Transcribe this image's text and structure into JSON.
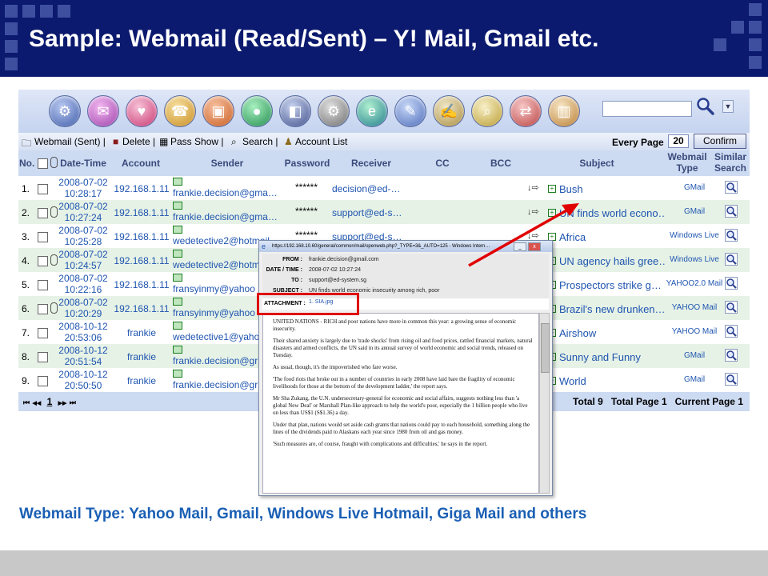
{
  "slide": {
    "title": "Sample: Webmail (Read/Sent) – Y! Mail, Gmail etc.",
    "caption": "Webmail Type: Yahoo Mail, Gmail, Windows Live Hotmail, Giga Mail and others"
  },
  "toolbar": {
    "icons": [
      "users-icon",
      "mail-icon",
      "lips-icon",
      "chat-icon",
      "package-icon",
      "globe-icon",
      "app-icon",
      "gear-icon",
      "ie-icon",
      "tools-icon",
      "notes-icon",
      "document-search-icon",
      "mail-arrows-icon",
      "bar-chart-icon"
    ],
    "search_value": ""
  },
  "menu": {
    "items": [
      "Webmail (Sent) |",
      "Delete |",
      "Pass Show |",
      "Search |",
      "Account List"
    ],
    "every_page_label": "Every Page",
    "every_page_value": "20",
    "confirm_label": "Confirm"
  },
  "table": {
    "headers": {
      "no": "No.",
      "datetime": "Date-Time",
      "account": "Account",
      "sender": "Sender",
      "password": "Password",
      "receiver": "Receiver",
      "cc": "CC",
      "bcc": "BCC",
      "subject": "Subject",
      "webmail_type": "Webmail Type",
      "similar_search": "Similar Search"
    },
    "rows": [
      {
        "no": "1.",
        "date": "2008-07-02",
        "time": "10:28:17",
        "account": "192.168.1.11",
        "sender": "frankie.decision@gma…",
        "password": "******",
        "receiver": "decision@ed-…",
        "subject": "Bush",
        "webmail": "GMail"
      },
      {
        "no": "2.",
        "date": "2008-07-02",
        "time": "10:27:24",
        "account": "192.168.1.11",
        "sender": "frankie.decision@gma…",
        "password": "******",
        "receiver": "support@ed-s…",
        "subject": "UN finds world econo…",
        "webmail": "GMail"
      },
      {
        "no": "3.",
        "date": "2008-07-02",
        "time": "10:25:28",
        "account": "192.168.1.11",
        "sender": "wedetective2@hotmail",
        "password": "******",
        "receiver": "support@ed-s…",
        "subject": "Africa",
        "webmail": "Windows Live"
      },
      {
        "no": "4.",
        "date": "2008-07-02",
        "time": "10:24:57",
        "account": "192.168.1.11",
        "sender": "wedetective2@hotmail",
        "password": "",
        "receiver": "",
        "subject": "UN agency hails gree…",
        "webmail": "Windows Live"
      },
      {
        "no": "5.",
        "date": "2008-07-02",
        "time": "10:22:16",
        "account": "192.168.1.11",
        "sender": "fransyinmy@yahoo",
        "password": "",
        "receiver": "",
        "subject": "Prospectors strike g…",
        "webmail": "YAHOO2.0 Mail"
      },
      {
        "no": "6.",
        "date": "2008-07-02",
        "time": "10:20:29",
        "account": "192.168.1.11",
        "sender": "fransyinmy@yahoo",
        "password": "",
        "receiver": "",
        "subject": "Brazil's new drunken…",
        "webmail": "YAHOO Mail"
      },
      {
        "no": "7.",
        "date": "2008-10-12",
        "time": "20:53:06",
        "account": "frankie",
        "sender": "wedetective1@yaho",
        "password": "",
        "receiver": "",
        "subject": "Airshow",
        "webmail": "YAHOO Mail"
      },
      {
        "no": "8.",
        "date": "2008-10-12",
        "time": "20:51:54",
        "account": "frankie",
        "sender": "frankie.decision@gr",
        "password": "",
        "receiver": "",
        "subject": "Sunny and Funny",
        "webmail": "GMail"
      },
      {
        "no": "9.",
        "date": "2008-10-12",
        "time": "20:50:50",
        "account": "frankie",
        "sender": "frankie.decision@gr",
        "password": "",
        "receiver": "",
        "subject": "World",
        "webmail": "GMail"
      }
    ]
  },
  "pager": {
    "nav_first": "⏮",
    "nav_prev": "◀◀",
    "current": "1",
    "nav_next": "▶▶",
    "nav_last": "⏭",
    "stats": "Total 9   Total Page 1   Current Page 1"
  },
  "popup": {
    "title": "https://192.168.10.60/general/common/mail/openweb.php?_TYPE=3&_AUTO=125 - Windows Intern…",
    "from_label": "FROM :",
    "from_value": "frankie.decision@gmail.com",
    "date_label": "DATE / TIME :",
    "date_value": "2008-07-02 10:27:24",
    "to_label": "TO :",
    "to_value": "support@ed-system.sg",
    "subject_label": "SUBJECT :",
    "subject_value": "UN finds world economic insecurity among rich, poor",
    "attachment_label": "ATTACHMENT :",
    "attachment_value": "1. SIA.jpg",
    "body": [
      "UNITED NATIONS - RICH and poor nations have more in common this year: a growing sense of economic insecurity.",
      "Their shared anxiety is largely due to 'trade shocks' from rising oil and food prices, rattled financial markets, natural disasters and armed conflicts, the UN said in its annual survey of world economic and social trends, released on Tuesday.",
      "As usual, though, it's the impoverished who fare worse.",
      "'The food riots that broke out in a number of countries in early 2008 have laid bare the fragility of economic livelihoods for those at the bottom of the development ladder,' the report says.",
      "Mr Sha Zukang, the U.N. undersecretary-general for economic and social affairs, suggests nothing less than 'a global New Deal' or Marshall Plan-like approach to help the world's poor, especially the 1 billion people who live on less than US$1 (S$1.36) a day.",
      "Under that plan, nations would set aside cash grants that nations could pay to each household, something along the lines of the dividends paid to Alaskans each year since 1980 from oil and gas money.",
      "'Such measures are, of course, fraught with complications and difficulties,' he says in the report."
    ]
  },
  "colors": {
    "header_bg": "#0b1a6e",
    "link_blue": "#1f55b0",
    "row_green": "#e6f2e6",
    "annotation_red": "#e00000",
    "caption_blue": "#1a5fb4"
  }
}
